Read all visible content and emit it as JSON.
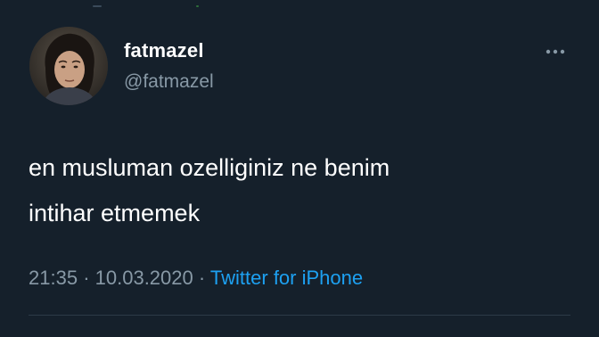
{
  "colors": {
    "background": "#15202b",
    "text_primary": "#ffffff",
    "text_secondary": "#8899a6",
    "link": "#1da1f2"
  },
  "tweet": {
    "author": {
      "display_name": "fatmazel",
      "handle": "@fatmazel",
      "avatar_icon": "user-avatar-photo"
    },
    "more_icon": "more-horizontal-icon",
    "text": "en musluman ozelliginiz ne benim\nintihar etmemek",
    "meta": {
      "time": "21:35",
      "separator": "·",
      "date": "10.03.2020",
      "source": "Twitter for iPhone"
    }
  }
}
